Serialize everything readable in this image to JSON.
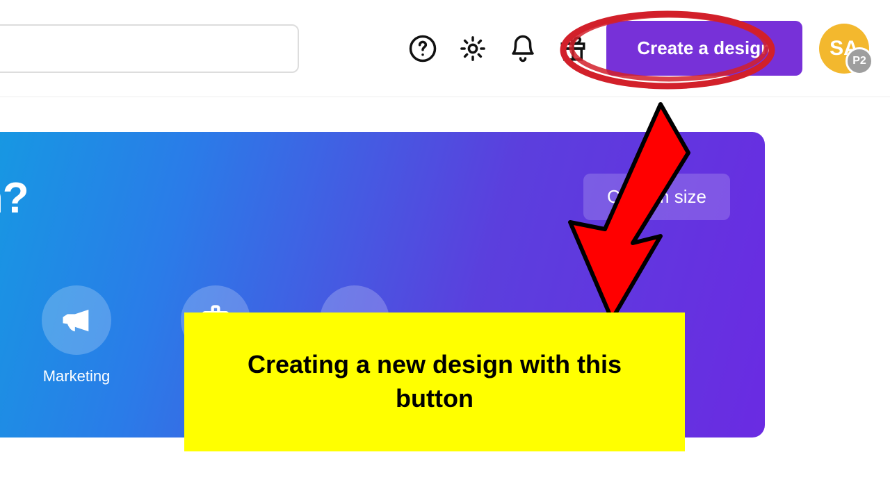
{
  "header": {
    "create_label": "Create a design",
    "avatar_initials": "SA",
    "avatar_badge": "P2"
  },
  "hero": {
    "title_fragment": "gn?",
    "custom_size_label": "Custom size",
    "categories": [
      {
        "name": "marketing",
        "label": "Marketing"
      },
      {
        "name": "office",
        "label": ""
      },
      {
        "name": "more",
        "label": ""
      }
    ]
  },
  "annotation": {
    "caption": "Creating a new design with this button"
  }
}
